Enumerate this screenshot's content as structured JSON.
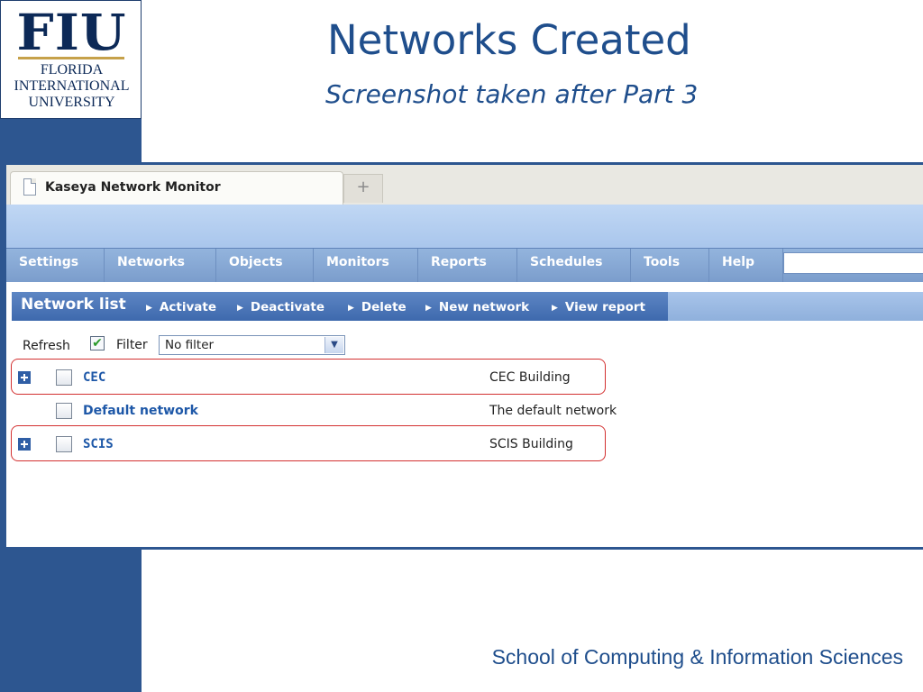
{
  "logo": {
    "mark": "FIU",
    "line1": "FLORIDA",
    "line2": "INTERNATIONAL",
    "line3": "UNIVERSITY"
  },
  "slide": {
    "title": "Networks Created",
    "subtitle": "Screenshot taken after Part 3",
    "footer": "School of Computing & Information Sciences"
  },
  "browser": {
    "tab_title": "Kaseya Network Monitor",
    "tab_icon": "page-icon",
    "new_tab_symbol": "+"
  },
  "menu": {
    "items": [
      {
        "label": "Settings"
      },
      {
        "label": "Networks"
      },
      {
        "label": "Objects"
      },
      {
        "label": "Monitors"
      },
      {
        "label": "Reports"
      },
      {
        "label": "Schedules"
      },
      {
        "label": "Tools"
      },
      {
        "label": "Help"
      }
    ],
    "search_value": ""
  },
  "toolbar": {
    "title": "Network list",
    "actions": [
      {
        "label": "Activate"
      },
      {
        "label": "Deactivate"
      },
      {
        "label": "Delete"
      },
      {
        "label": "New network"
      },
      {
        "label": "View report"
      }
    ]
  },
  "filter": {
    "refresh_label": "Refresh",
    "checked": true,
    "check_mark": "✔",
    "label": "Filter",
    "selected": "No filter",
    "arrow": "▼"
  },
  "networks": [
    {
      "name": "CEC",
      "description": "CEC Building",
      "expandable": true,
      "highlighted": true
    },
    {
      "name": "Default network",
      "description": "The default network",
      "expandable": false,
      "highlighted": false
    },
    {
      "name": "SCIS",
      "description": "SCIS Building",
      "expandable": true,
      "highlighted": true
    }
  ],
  "colors": {
    "brand_navy": "#0c2957",
    "slide_blue": "#1f4e8c",
    "link_blue": "#1e58a8",
    "highlight_red": "#d33030",
    "fiu_gold": "#c6a14a"
  }
}
